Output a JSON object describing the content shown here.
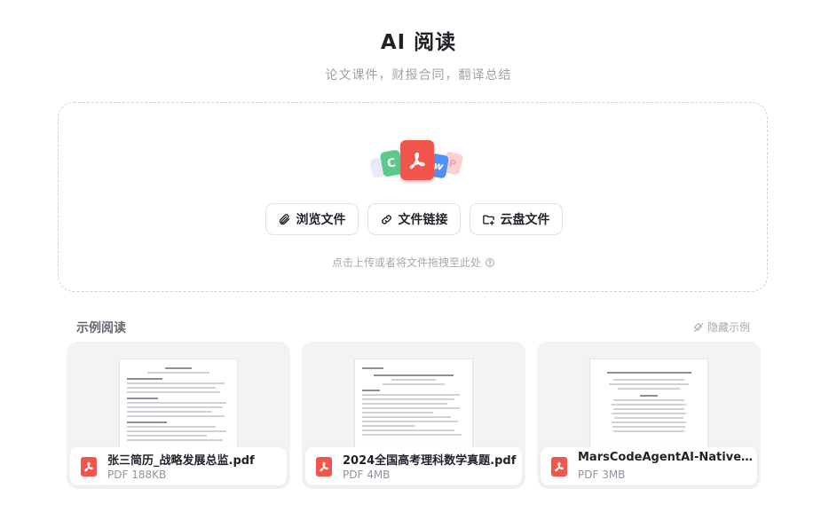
{
  "header": {
    "title": "AI 阅读",
    "subtitle": "论文课件，财报合同，翻译总结"
  },
  "upload": {
    "icons": [
      "grey-doc-icon",
      "csv-icon",
      "pdf-icon",
      "word-icon",
      "ppt-icon"
    ],
    "stack_letters": {
      "c": "C",
      "w": "w",
      "p": "P"
    },
    "buttons": [
      {
        "label": "浏览文件",
        "icon": "paperclip-icon"
      },
      {
        "label": "文件链接",
        "icon": "link-icon"
      },
      {
        "label": "云盘文件",
        "icon": "cloud-folder-icon"
      }
    ],
    "hint": "点击上传或者将文件拖拽至此处"
  },
  "examples": {
    "title": "示例阅读",
    "hide_label": "隐藏示例",
    "items": [
      {
        "name": "张三简历_战略发展总监.pdf",
        "type": "PDF",
        "size": "188KB",
        "meta": "PDF 188KB"
      },
      {
        "name": "2024全国高考理科数学真题.pdf",
        "type": "PDF",
        "size": "4MB",
        "meta": "PDF 4MB"
      },
      {
        "name": "MarsCodeAgentAI-NativeAutomatedBugFixing.pdf",
        "type": "PDF",
        "size": "3MB",
        "meta": "PDF 3MB"
      }
    ]
  },
  "colors": {
    "pdf_red": "#f2554b",
    "csv_green": "#5cc98c",
    "word_blue": "#4f8ff7",
    "ppt_pink": "#fbd2d2"
  }
}
